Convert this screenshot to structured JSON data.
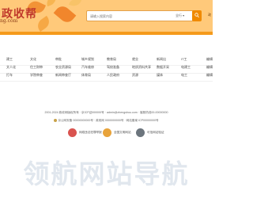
{
  "header": {
    "logo_title": "政收帮",
    "logo_domain": "ng.com",
    "search": {
      "placeholder": "请输入搜索内容",
      "select_value": "全行 ▾"
    },
    "right_text": "政"
  },
  "categories": [
    [
      "建工",
      "文化",
      "审批",
      "城乡规划",
      "教育局",
      "就业",
      "新闻出",
      "IT工",
      "编辑"
    ],
    [
      "文人化",
      "住工财审",
      "农业资源局",
      "汽车维修",
      "驾校准备",
      "地质资料共享",
      "数据开采",
      "电建工",
      "编辑"
    ],
    [
      "打车",
      "学院审查",
      "新闻审查厅",
      "体育局",
      "人民政府",
      "资源",
      "媒体",
      "电工",
      "编辑"
    ]
  ],
  "footer": {
    "line1": "2001-2024 政收网版权所有 · 京ICP证000000号 · admin@zhengshou.com · 客服热线00-00000000",
    "line2": "京公网安备 00000000000号 · 政收网 0000000000号 · 网站备案 ICP00000000号"
  },
  "badges": [
    {
      "label": "网络违法犯罪举报",
      "color": "#d9534f"
    },
    {
      "label": "全国文明网站",
      "color": "#e8a33b"
    },
    {
      "label": "可信网站验证",
      "color": "#6c757d"
    }
  ],
  "watermark": "领航网站导航"
}
